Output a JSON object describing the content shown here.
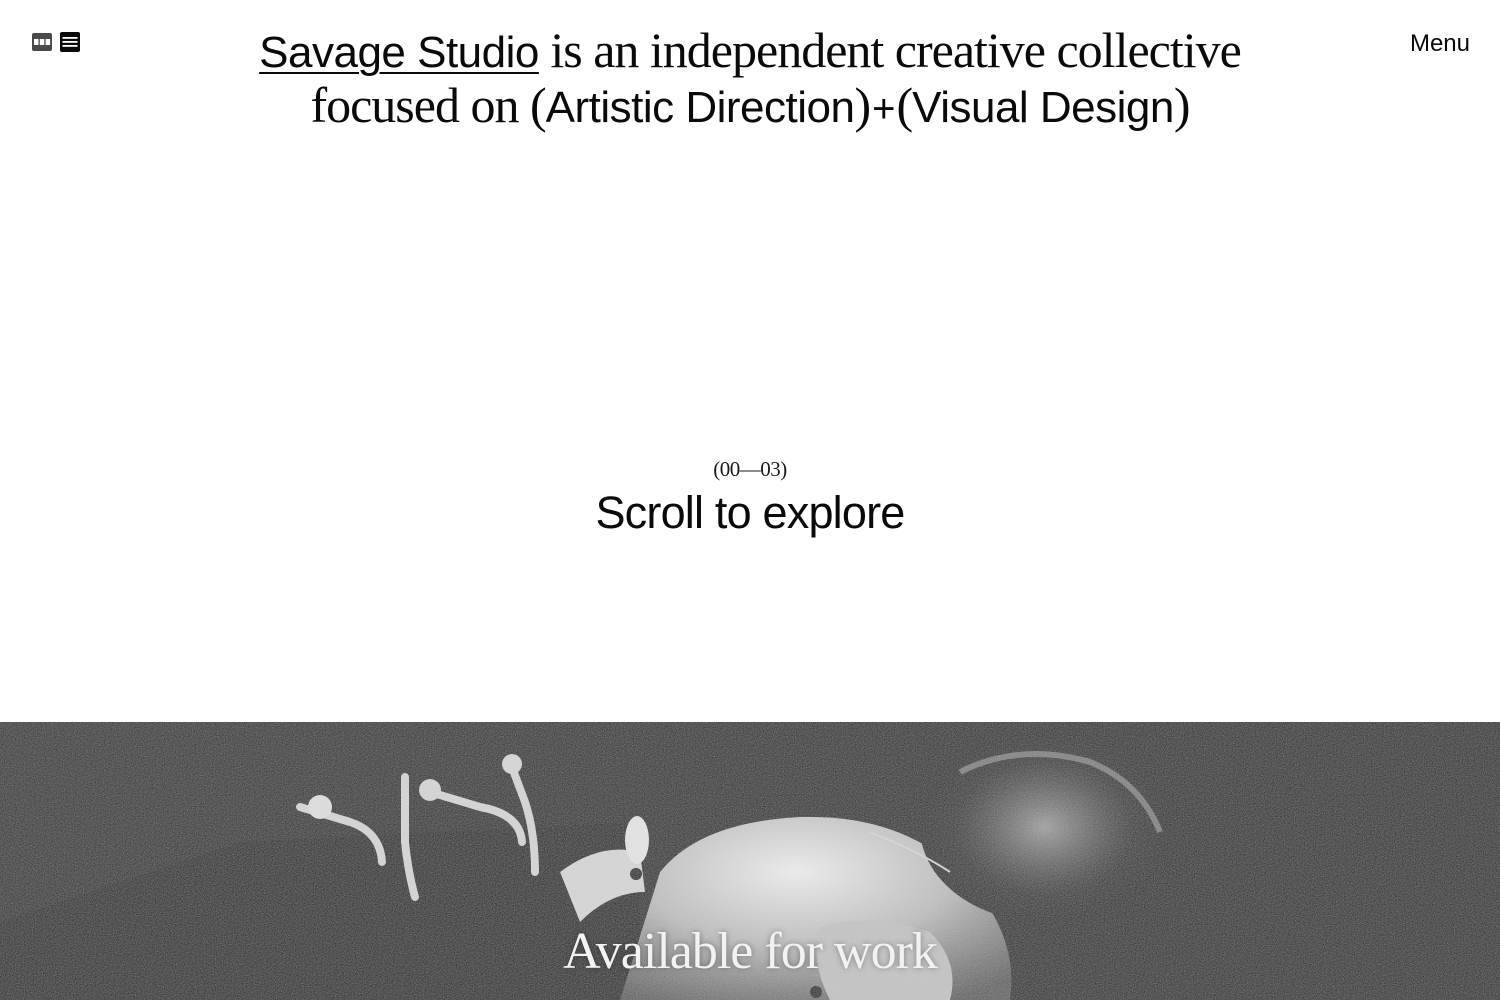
{
  "header": {
    "view_toggles": [
      {
        "icon": "grid-view-icon",
        "label": "Grid view"
      },
      {
        "icon": "list-view-icon",
        "label": "List view"
      }
    ],
    "menu_label": "Menu"
  },
  "hero": {
    "studio_name": "Savage Studio",
    "line1_rest": "is an independent creative collective",
    "line2_prefix": "focused on",
    "open_paren_1": "(",
    "focus_1": "Artistic Direction",
    "close_paren_1": ")",
    "plus": "+",
    "open_paren_2": "(",
    "focus_2": "Visual Design",
    "close_paren_2": ")"
  },
  "scroll": {
    "counter": "(00—03)",
    "label": "Scroll to explore"
  },
  "photo": {
    "caption": "Available for work",
    "tone": "grayscale"
  },
  "colors": {
    "background": "#ffffff",
    "text": "#0a0a0a",
    "photo_dark": "#1d1d1d"
  }
}
